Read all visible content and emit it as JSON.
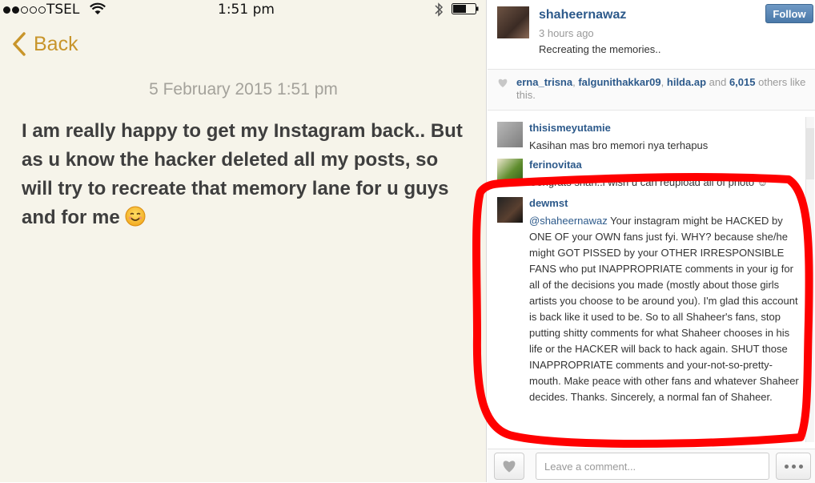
{
  "status_bar": {
    "carrier": "TSEL",
    "time": "1:51 pm",
    "signal_filled": 2,
    "signal_total": 5,
    "icons": [
      "signal-dots-icon",
      "wifi-icon",
      "bluetooth-icon",
      "battery-icon"
    ]
  },
  "notes": {
    "back_label": "Back",
    "date": "5 February 2015 1:51 pm",
    "body": "I am really happy to get my Instagram back.. But as u know the hacker deleted all my posts, so will try to recreate that memory lane for u guys and for me",
    "emoji_icon": "smiling-face-icon",
    "accent_color": "#c8952b"
  },
  "post": {
    "username": "shaheernawaz",
    "time_ago": "3 hours ago",
    "caption": "Recreating the memories..",
    "follow_label": "Follow"
  },
  "likes": {
    "liker_1": "erna_trisna",
    "sep_1": ", ",
    "liker_2": "falgunithakkar09",
    "sep_2": ", ",
    "liker_3": "hilda.ap",
    "and_label": " and ",
    "count": "6,015",
    "suffix": " others like this."
  },
  "comments": [
    {
      "user": "thisismeyutamie",
      "text": "Kasihan mas bro memori nya terhapus"
    },
    {
      "user": "ferinovitaa",
      "text": "Congrats shah..i wish u can reupload all of photo ☺"
    },
    {
      "user": "dewmst",
      "mention": "@shaheernawaz",
      "text": " Your instagram might be HACKED by ONE OF your OWN fans just fyi. WHY? because she/he might GOT PISSED by your OTHER IRRESPONSIBLE FANS who put INAPPROPRIATE comments in your ig for all of the decisions you made (mostly about those girls artists you choose to be around you). I'm glad this account is back like it used to be. So to all Shaheer's fans, stop putting shitty comments for what Shaheer chooses in his life or the HACKER will back to hack again. SHUT those INAPPROPRIATE comments and your-not-so-pretty-mouth. Make peace with other fans and whatever Shaheer decides. Thanks. Sincerely, a normal fan of Shaheer."
    }
  ],
  "footer": {
    "comment_placeholder": "Leave a comment..."
  },
  "colors": {
    "link_blue": "#2d5a8b",
    "highlight_red": "#ff0000",
    "follow_button": "#5584b5"
  }
}
